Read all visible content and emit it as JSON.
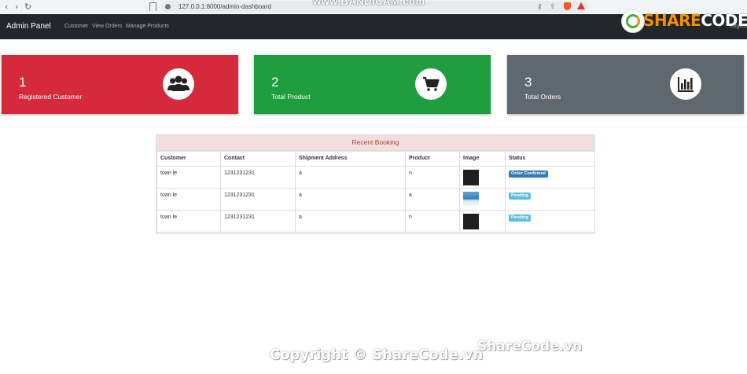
{
  "browser": {
    "url": "127.0.0.1:8000/admin-dashboard",
    "back_glyph": "‹",
    "forward_glyph": "›",
    "reload_glyph": "↻",
    "key_glyph": "⚷",
    "share_glyph": "⇪"
  },
  "recorder_watermark": "www.BANDICAM.com",
  "navbar": {
    "brand": "Admin Panel",
    "links": [
      "Customer",
      "View Orders",
      "Manage Products"
    ],
    "logout": "Logout"
  },
  "logo": {
    "text_prefix": "SHARE",
    "text_suffix": "CODE.vn"
  },
  "stats": [
    {
      "value": "1",
      "label": "Registered Customer",
      "icon": "users-icon",
      "color": "#d42a3c"
    },
    {
      "value": "2",
      "label": "Total Product",
      "icon": "cart-icon",
      "color": "#1e9e3e"
    },
    {
      "value": "3",
      "label": "Total Orders",
      "icon": "bar-chart-icon",
      "color": "#5f676f"
    }
  ],
  "booking": {
    "title": "Recent Booking",
    "columns": [
      "Customer",
      "Contact",
      "Shipment Address",
      "Product",
      "Image",
      "Status"
    ],
    "rows": [
      {
        "customer": "toan le",
        "contact": "1231231231",
        "address": "a",
        "product": "n",
        "image": "dark",
        "status": "Order Confirmed",
        "status_color": "#337ab7"
      },
      {
        "customer": "toan le",
        "contact": "1231231231",
        "address": "a",
        "product": "a",
        "image": "blue",
        "status": "Pending",
        "status_color": "#5bc0de"
      },
      {
        "customer": "toan le",
        "contact": "1231231231",
        "address": "a",
        "product": "n",
        "image": "dark",
        "status": "Pending",
        "status_color": "#5bc0de"
      }
    ]
  },
  "watermark": {
    "copyright": "Copyright © ShareCode.vn",
    "site": "ShareCode.vn"
  }
}
